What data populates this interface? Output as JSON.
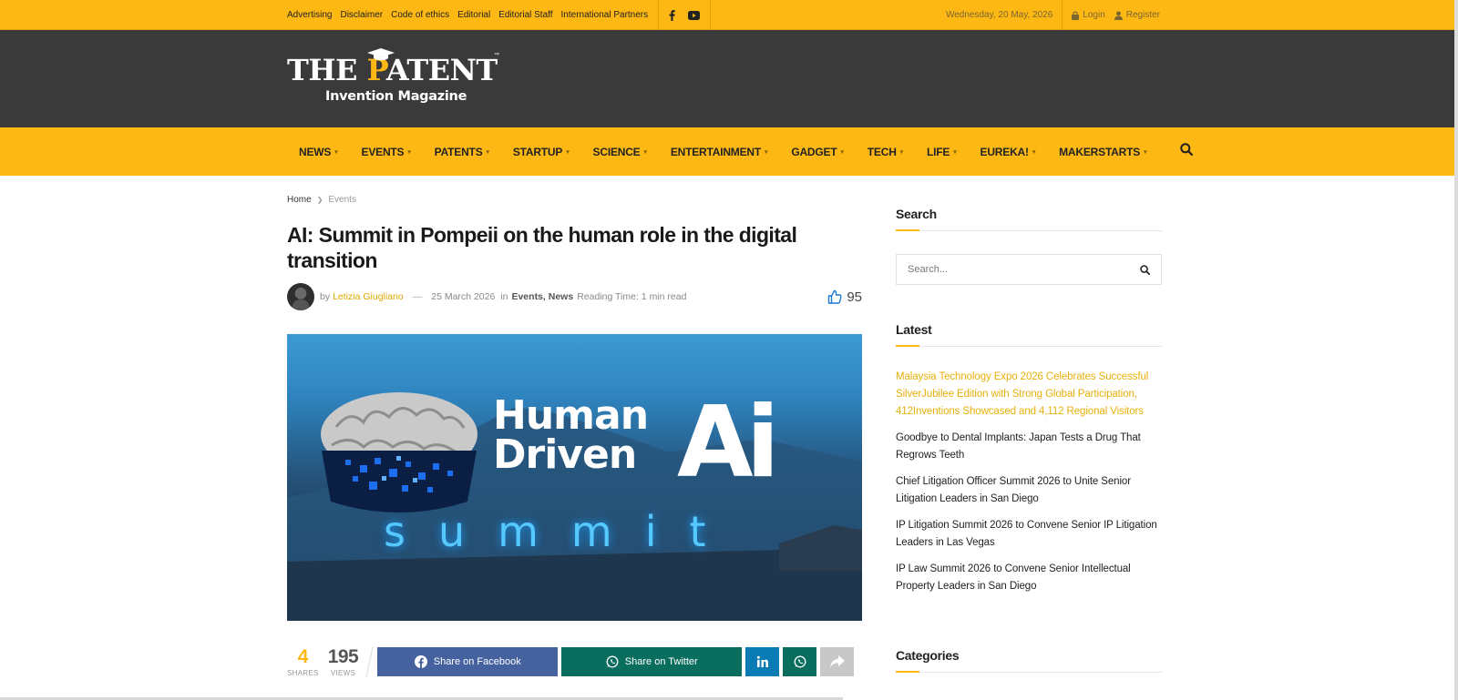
{
  "topbar": {
    "links": [
      "Advertising",
      "Disclaimer",
      "Code of ethics",
      "Editorial",
      "Editorial Staff",
      "International Partners"
    ],
    "date": "Wednesday, 20 May, 2026",
    "login": "Login",
    "register": "Register"
  },
  "brand": {
    "name_left": "THE ",
    "name_p": "P",
    "name_right": "ATENT",
    "tm": "™",
    "subtitle": "Invention Magazine"
  },
  "nav": {
    "items": [
      "NEWS",
      "EVENTS",
      "PATENTS",
      "STARTUP",
      "SCIENCE",
      "ENTERTAINMENT",
      "GADGET",
      "TECH",
      "LIFE",
      "EUREKA!",
      "MAKERSTARTS"
    ]
  },
  "breadcrumb": {
    "home": "Home",
    "current": "Events"
  },
  "article": {
    "title": "AI: Summit in Pompeii on the human role in the digital transition",
    "by": "by",
    "author": "Letizia Giugliano",
    "dash": "—",
    "date": "25 March 2026",
    "in": "in",
    "cat1": "Events",
    "cat_sep": ",",
    "cat2": "News",
    "reading_time": "Reading Time: 1 min read",
    "likes": "95"
  },
  "hero": {
    "line1": "Human",
    "line2": "Driven",
    "ai": "Ai",
    "summit": "summit"
  },
  "share": {
    "shares_count": "4",
    "shares_label": "SHARES",
    "views_count": "195",
    "views_label": "VIEWS",
    "facebook": "Share on Facebook",
    "twitter": "Share on Twitter"
  },
  "sidebar": {
    "search_title": "Search",
    "search_placeholder": "Search...",
    "latest_title": "Latest",
    "latest": [
      "Malaysia Technology Expo 2026 Celebrates Successful SilverJubilee Edition with Strong Global Participation, 412Inventions Showcased and 4,112 Regional Visitors",
      "Goodbye to Dental Implants: Japan Tests a Drug That Regrows Teeth",
      "Chief Litigation Officer Summit 2026 to Unite Senior Litigation Leaders in San Diego",
      "IP Litigation Summit 2026 to Convene Senior IP Litigation Leaders in Las Vegas",
      "IP Law Summit 2026 to Convene Senior Intellectual Property Leaders in San Diego"
    ],
    "categories_title": "Categories"
  },
  "colors": {
    "accent": "#fdb813",
    "header_bg": "#3a3a3a",
    "facebook": "#45629f",
    "twitter": "#0a6e5f",
    "linkedin": "#0a7bb4"
  },
  "icons": [
    "facebook-icon",
    "youtube-icon",
    "lock-icon",
    "user-icon",
    "search-icon",
    "thumbs-up-icon",
    "linkedin-icon",
    "whatsapp-icon",
    "share-arrow-icon",
    "chevron-down-icon"
  ]
}
